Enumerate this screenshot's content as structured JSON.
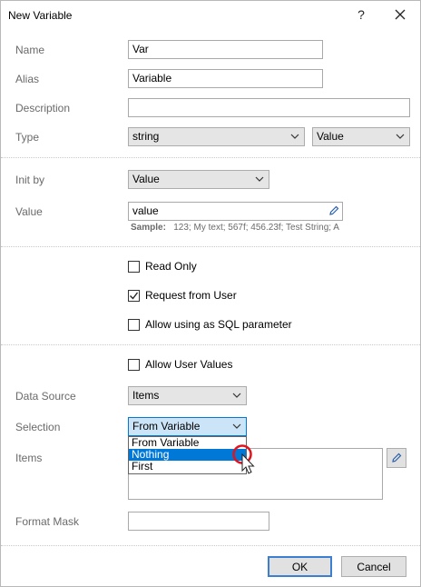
{
  "window": {
    "title": "New Variable",
    "help_label": "?",
    "close_label": "✕"
  },
  "fields": {
    "name": {
      "label": "Name",
      "value": "Var"
    },
    "alias": {
      "label": "Alias",
      "value": "Variable"
    },
    "description": {
      "label": "Description",
      "value": ""
    },
    "type": {
      "label": "Type",
      "value": "string",
      "kind": "Value"
    },
    "init_by": {
      "label": "Init by",
      "value": "Value"
    },
    "value": {
      "label": "Value",
      "value": "value",
      "sample_label": "Sample:",
      "sample_text": "123; My text; 567f; 456.23f; Test String; A"
    },
    "read_only": {
      "label": "Read Only",
      "checked": false
    },
    "request_from_user": {
      "label": "Request from User",
      "checked": true
    },
    "allow_sql": {
      "label": "Allow using as SQL parameter",
      "checked": false
    },
    "allow_user_values": {
      "label": "Allow User Values",
      "checked": false
    },
    "data_source": {
      "label": "Data Source",
      "value": "Items"
    },
    "selection": {
      "label": "Selection",
      "value": "From Variable",
      "options": [
        "From Variable",
        "Nothing",
        "First"
      ],
      "highlighted": "Nothing"
    },
    "items": {
      "label": "Items"
    },
    "format_mask": {
      "label": "Format Mask",
      "value": ""
    }
  },
  "buttons": {
    "ok": "OK",
    "cancel": "Cancel"
  },
  "colors": {
    "accent": "#0078d7",
    "default_border": "#3c7fd1",
    "cursor_ring": "#e0141e"
  },
  "icons": {
    "edit": "pencil-icon",
    "dropdown": "chevron-down-icon",
    "check": "checkmark-icon"
  }
}
